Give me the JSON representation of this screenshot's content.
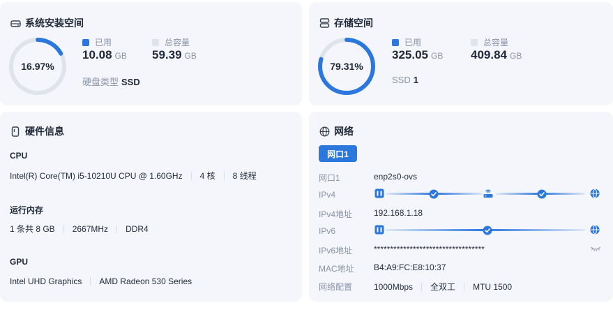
{
  "system_storage": {
    "title": "系统安装空间",
    "percent": "16.97%",
    "percent_value": 16.97,
    "used_label": "已用",
    "used_value": "10.08",
    "used_unit": "GB",
    "total_label": "总容量",
    "total_value": "59.39",
    "total_unit": "GB",
    "disk_type_label": "硬盘类型",
    "disk_type_value": "SSD"
  },
  "storage": {
    "title": "存储空间",
    "percent": "79.31%",
    "percent_value": 79.31,
    "used_label": "已用",
    "used_value": "325.05",
    "used_unit": "GB",
    "total_label": "总容量",
    "total_value": "409.84",
    "total_unit": "GB",
    "ssd_label": "SSD",
    "ssd_count": "1"
  },
  "hardware": {
    "title": "硬件信息",
    "cpu_label": "CPU",
    "cpu_model": "Intel(R) Core(TM) i5-10210U CPU @ 1.60GHz",
    "cpu_cores": "4 核",
    "cpu_threads": "8 线程",
    "mem_label": "运行内存",
    "mem_amount": "1 条共 8 GB",
    "mem_speed": "2667MHz",
    "mem_type": "DDR4",
    "gpu_label": "GPU",
    "gpu_1": "Intel UHD Graphics",
    "gpu_2": "AMD Radeon 530 Series"
  },
  "network": {
    "title": "网络",
    "tab": "网口1",
    "port_label": "网口1",
    "port_value": "enp2s0-ovs",
    "ipv4_label": "IPv4",
    "ipv4_addr_label": "IPv4地址",
    "ipv4_addr_value": "192.168.1.18",
    "ipv6_label": "IPv6",
    "ipv6_addr_label": "IPv6地址",
    "ipv6_addr_value": "**********************************",
    "mac_label": "MAC地址",
    "mac_value": "B4:A9:FC:E8:10:37",
    "config_label": "网络配置",
    "config_speed": "1000Mbps",
    "config_duplex": "全双工",
    "config_mtu": "MTU 1500"
  },
  "colors": {
    "accent": "#2b77dc",
    "track": "#dfe3ea",
    "card_bg": "#f4f6fb"
  }
}
